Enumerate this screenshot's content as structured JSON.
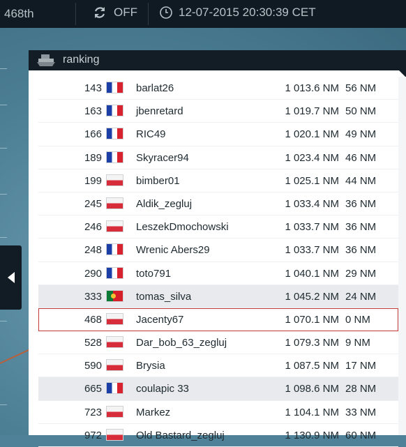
{
  "topbar": {
    "rank": "468th",
    "sync_label": "OFF",
    "datetime": "12-07-2015 20:30:39 CET"
  },
  "panel": {
    "title": "ranking"
  },
  "ranking": [
    {
      "pos": "143",
      "flag": "fr",
      "name": "barlat26",
      "dist": "1 013.6 NM",
      "gap": "56 NM",
      "style": ""
    },
    {
      "pos": "163",
      "flag": "fr",
      "name": "jbenretard",
      "dist": "1 019.7 NM",
      "gap": "50 NM",
      "style": ""
    },
    {
      "pos": "166",
      "flag": "fr",
      "name": "RIC49",
      "dist": "1 020.1 NM",
      "gap": "49 NM",
      "style": ""
    },
    {
      "pos": "189",
      "flag": "fr",
      "name": "Skyracer94",
      "dist": "1 023.4 NM",
      "gap": "46 NM",
      "style": ""
    },
    {
      "pos": "199",
      "flag": "pl",
      "name": "bimber01",
      "dist": "1 025.1 NM",
      "gap": "44 NM",
      "style": ""
    },
    {
      "pos": "245",
      "flag": "pl",
      "name": "Aldik_zegluj",
      "dist": "1 033.4 NM",
      "gap": "36 NM",
      "style": ""
    },
    {
      "pos": "246",
      "flag": "pl",
      "name": "LeszekDmochowski",
      "dist": "1 033.7 NM",
      "gap": "36 NM",
      "style": ""
    },
    {
      "pos": "248",
      "flag": "fr",
      "name": "Wrenic Abers29",
      "dist": "1 033.7 NM",
      "gap": "36 NM",
      "style": ""
    },
    {
      "pos": "290",
      "flag": "fr",
      "name": "toto791",
      "dist": "1 040.1 NM",
      "gap": "29 NM",
      "style": ""
    },
    {
      "pos": "333",
      "flag": "pt",
      "name": "tomas_silva",
      "dist": "1 045.2 NM",
      "gap": "24 NM",
      "style": "grey"
    },
    {
      "pos": "468",
      "flag": "pl",
      "name": "Jacenty67",
      "dist": "1 070.1 NM",
      "gap": "0 NM",
      "style": "selected"
    },
    {
      "pos": "528",
      "flag": "pl",
      "name": "Dar_bob_63_zegluj",
      "dist": "1 079.3 NM",
      "gap": "9 NM",
      "style": ""
    },
    {
      "pos": "590",
      "flag": "pl",
      "name": "Brysia",
      "dist": "1 087.5 NM",
      "gap": "17 NM",
      "style": ""
    },
    {
      "pos": "665",
      "flag": "fr",
      "name": "coulapic 33",
      "dist": "1 098.6 NM",
      "gap": "28 NM",
      "style": "grey"
    },
    {
      "pos": "723",
      "flag": "pl",
      "name": "Markez",
      "dist": "1 104.1 NM",
      "gap": "33 NM",
      "style": ""
    },
    {
      "pos": "972",
      "flag": "pl",
      "name": "Old Bastard_zegluj",
      "dist": "1 130.9 NM",
      "gap": "60 NM",
      "style": ""
    }
  ],
  "icons": {
    "sync": "sync-icon",
    "clock": "clock-icon",
    "boat": "boat-icon",
    "collapse": "chevron-left-icon"
  }
}
